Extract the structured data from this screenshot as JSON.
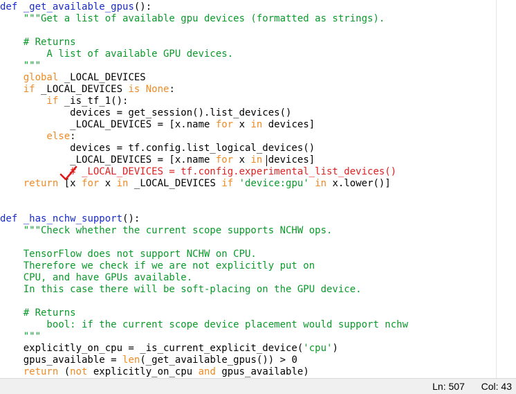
{
  "editor": {
    "lines": [
      [
        {
          "t": "def",
          "c": "fn"
        },
        {
          "t": " _get_available_gpus",
          "c": "fn"
        },
        {
          "t": "():",
          "c": ""
        }
      ],
      [
        {
          "t": "    \"\"\"Get a list of available gpu devices (formatted as strings).",
          "c": "str"
        }
      ],
      [
        {
          "t": "",
          "c": ""
        }
      ],
      [
        {
          "t": "    # Returns",
          "c": "cmt"
        }
      ],
      [
        {
          "t": "        A list of available GPU devices.",
          "c": "str"
        }
      ],
      [
        {
          "t": "    \"\"\"",
          "c": "str"
        }
      ],
      [
        {
          "t": "    global",
          "c": "kw"
        },
        {
          "t": " _LOCAL_DEVICES",
          "c": ""
        }
      ],
      [
        {
          "t": "    if",
          "c": "kw"
        },
        {
          "t": " _LOCAL_DEVICES ",
          "c": ""
        },
        {
          "t": "is None",
          "c": "kw"
        },
        {
          "t": ":",
          "c": ""
        }
      ],
      [
        {
          "t": "        if",
          "c": "kw"
        },
        {
          "t": " _is_tf_1():",
          "c": ""
        }
      ],
      [
        {
          "t": "            devices = get_session().list_devices()",
          "c": ""
        }
      ],
      [
        {
          "t": "            _LOCAL_DEVICES = [x.name ",
          "c": ""
        },
        {
          "t": "for",
          "c": "kw"
        },
        {
          "t": " x ",
          "c": ""
        },
        {
          "t": "in",
          "c": "kw"
        },
        {
          "t": " devices]",
          "c": ""
        }
      ],
      [
        {
          "t": "        else",
          "c": "kw"
        },
        {
          "t": ":",
          "c": ""
        }
      ],
      [
        {
          "t": "            devices = tf.config.list_logical_devices()",
          "c": ""
        }
      ],
      [
        {
          "t": "            _LOCAL_DEVICES = [x.name ",
          "c": ""
        },
        {
          "t": "for",
          "c": "kw"
        },
        {
          "t": " x ",
          "c": ""
        },
        {
          "t": "in",
          "c": "kw"
        },
        {
          "t": " devices]",
          "c": ""
        }
      ],
      [
        {
          "t": "            # _LOCAL_DEVICES = tf.config.experimental_list_devices()",
          "c": "red"
        }
      ],
      [
        {
          "t": "    return",
          "c": "kw"
        },
        {
          "t": " [x ",
          "c": ""
        },
        {
          "t": "for",
          "c": "kw"
        },
        {
          "t": " x ",
          "c": ""
        },
        {
          "t": "in",
          "c": "kw"
        },
        {
          "t": " _LOCAL_DEVICES ",
          "c": ""
        },
        {
          "t": "if",
          "c": "kw"
        },
        {
          "t": " 'device:gpu' ",
          "c": "str"
        },
        {
          "t": "in",
          "c": "kw"
        },
        {
          "t": " x.lower()]",
          "c": ""
        }
      ],
      [
        {
          "t": "",
          "c": ""
        }
      ],
      [
        {
          "t": "",
          "c": ""
        }
      ],
      [
        {
          "t": "def",
          "c": "fn"
        },
        {
          "t": " _has_nchw_support",
          "c": "fn"
        },
        {
          "t": "():",
          "c": ""
        }
      ],
      [
        {
          "t": "    \"\"\"Check whether the current scope supports NCHW ops.",
          "c": "str"
        }
      ],
      [
        {
          "t": "",
          "c": ""
        }
      ],
      [
        {
          "t": "    TensorFlow does not support NCHW on CPU.",
          "c": "str"
        }
      ],
      [
        {
          "t": "    Therefore we check if we are not explicitly put on",
          "c": "str"
        }
      ],
      [
        {
          "t": "    CPU, and have GPUs available.",
          "c": "str"
        }
      ],
      [
        {
          "t": "    In this case there will be soft-placing on the GPU device.",
          "c": "str"
        }
      ],
      [
        {
          "t": "",
          "c": ""
        }
      ],
      [
        {
          "t": "    # Returns",
          "c": "cmt"
        }
      ],
      [
        {
          "t": "        bool: if the current scope device placement would support nchw",
          "c": "str"
        }
      ],
      [
        {
          "t": "    \"\"\"",
          "c": "str"
        }
      ],
      [
        {
          "t": "    explicitly_on_cpu = _is_current_explicit_device(",
          "c": ""
        },
        {
          "t": "'cpu'",
          "c": "str"
        },
        {
          "t": ")",
          "c": ""
        }
      ],
      [
        {
          "t": "    gpus_available = ",
          "c": ""
        },
        {
          "t": "len",
          "c": "kw"
        },
        {
          "t": "(_get_available_gpus()) > 0",
          "c": ""
        }
      ],
      [
        {
          "t": "    return",
          "c": "kw"
        },
        {
          "t": " (",
          "c": ""
        },
        {
          "t": "not",
          "c": "kw"
        },
        {
          "t": " explicitly_on_cpu ",
          "c": ""
        },
        {
          "t": "and",
          "c": "kw"
        },
        {
          "t": " gpus_available)",
          "c": ""
        }
      ]
    ]
  },
  "status": {
    "line_label": "Ln: 507",
    "col_label": "Col: 43"
  },
  "colors": {
    "keyword": "#f08a24",
    "string": "#0a9a2a",
    "comment_red": "#e02020",
    "function": "#1a2bc8",
    "checkmark": "#e01818"
  },
  "icons": {
    "checkmark": "check-annotation-icon"
  }
}
